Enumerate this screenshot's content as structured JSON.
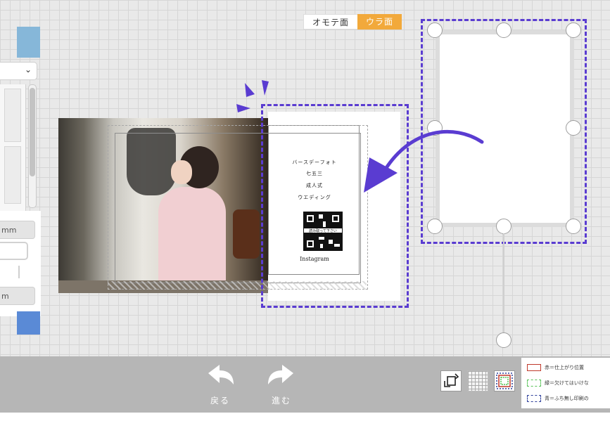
{
  "tabs": {
    "front": "オモテ面",
    "back": "ウラ面"
  },
  "left_panel": {
    "unit_top": "mm",
    "unit_bottom": "m"
  },
  "card_text": {
    "line1": "バースデーフォト",
    "line2": "七五三",
    "line3": "成人式",
    "line4": "ウエディング",
    "qr_caption": "読み取って下さい",
    "instagram": "Instagram"
  },
  "bottom": {
    "undo_label": "戻る",
    "redo_label": "進む"
  },
  "legend": {
    "red": "赤＝仕上がり位置",
    "green": "緑＝欠けてはいけな",
    "blue": "青＝ふち無し印刷の"
  },
  "colors": {
    "accent_tab": "#f2a93b",
    "guide_purple": "#5a3cd1",
    "legend_red": "#c0392b",
    "legend_green": "#55c255",
    "legend_blue": "#2c3e9a"
  },
  "icons": [
    "chevron-down-icon",
    "undo-arrow-icon",
    "redo-arrow-icon",
    "rotate-icon",
    "grid-icon",
    "guides-icon",
    "curved-arrow-icon",
    "sparkle-icon"
  ]
}
